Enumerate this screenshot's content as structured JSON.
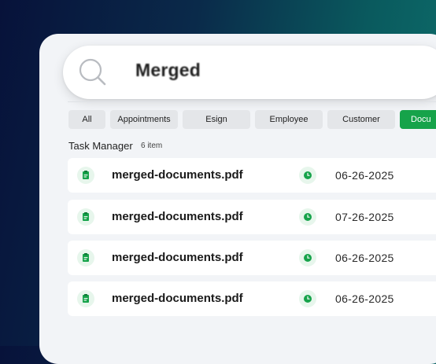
{
  "search": {
    "value": "Merged"
  },
  "filters": [
    {
      "label": "All",
      "active": false
    },
    {
      "label": "Appointments",
      "active": false
    },
    {
      "label": "Esign",
      "active": false
    },
    {
      "label": "Employee",
      "active": false
    },
    {
      "label": "Customer",
      "active": false
    },
    {
      "label": "Docu",
      "active": true
    }
  ],
  "section": {
    "title": "Task Manager",
    "count": "6 item"
  },
  "rows": [
    {
      "name": "merged-documents.pdf",
      "date": "06-26-2025"
    },
    {
      "name": "merged-documents.pdf",
      "date": "07-26-2025"
    },
    {
      "name": "merged-documents.pdf",
      "date": "06-26-2025"
    },
    {
      "name": "merged-documents.pdf",
      "date": "06-26-2025"
    }
  ],
  "icons": {
    "search": "search-icon",
    "file": "clipboard-file-icon",
    "date": "clock-icon"
  },
  "colors": {
    "accent": "#16a34a",
    "icon_bg": "#e7f6ec"
  }
}
